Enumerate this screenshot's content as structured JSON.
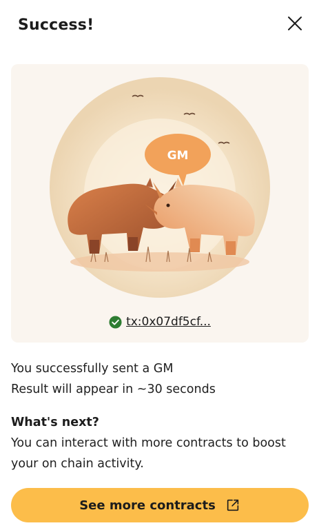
{
  "modal": {
    "title": "Success!"
  },
  "transaction": {
    "link_text": "tx:0x07df5cf...",
    "status": "confirmed"
  },
  "illustration": {
    "speech_bubble_text": "GM"
  },
  "message": {
    "line1": "You successfully sent a GM",
    "line2": "Result will appear in ~30 seconds"
  },
  "next": {
    "title": "What's next?",
    "body": "You can interact with more contracts to boost your on chain activity."
  },
  "cta": {
    "label": "See more contracts"
  },
  "colors": {
    "accent": "#fcbd4a",
    "card_bg": "#faf5ef",
    "success_green": "#2e7d32",
    "bubble_orange": "#f2a25a"
  },
  "icons": {
    "close": "close-icon",
    "check": "check-circle-icon",
    "external": "external-link-icon"
  }
}
